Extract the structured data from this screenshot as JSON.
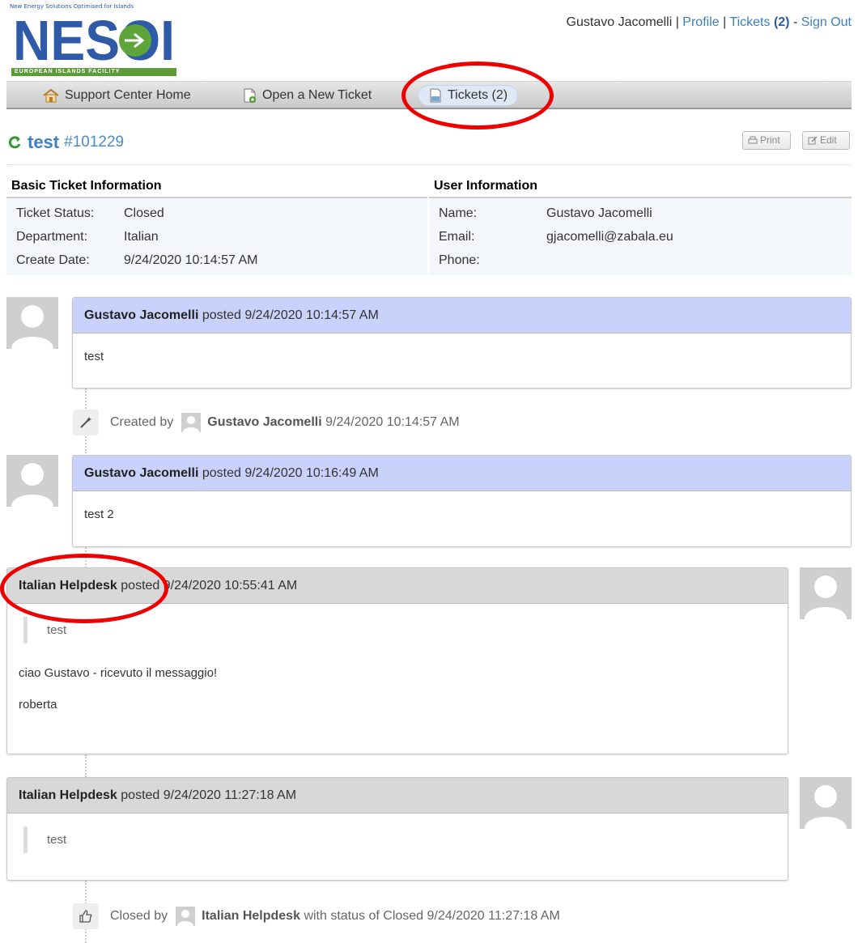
{
  "logo": {
    "tagline": "New Energy Solutions Optimised for Islands",
    "wordmark": "NESOI",
    "banner": "EUROPEAN ISLANDS FACILITY"
  },
  "userbar": {
    "user_name": "Gustavo Jacomelli",
    "sep1": " | ",
    "profile": "Profile",
    "sep2": " | ",
    "tickets_label": "Tickets",
    "tickets_count": "(2)",
    "sep3": " - ",
    "sign_out": "Sign Out"
  },
  "nav": {
    "home": "Support Center Home",
    "new_ticket": "Open a New Ticket",
    "tickets": "Tickets (2)"
  },
  "ticket": {
    "title": "test",
    "number": "#101229",
    "print": "Print",
    "edit": "Edit"
  },
  "basic_info": {
    "heading": "Basic Ticket Information",
    "rows": [
      {
        "label": "Ticket Status:",
        "value": "Closed"
      },
      {
        "label": "Department:",
        "value": "Italian"
      },
      {
        "label": "Create Date:",
        "value": "9/24/2020 10:14:57 AM"
      }
    ]
  },
  "user_info": {
    "heading": "User Information",
    "rows": [
      {
        "label": "Name:",
        "value": "Gustavo Jacomelli"
      },
      {
        "label": "Email:",
        "value": "gjacomelli@zabala.eu"
      },
      {
        "label": "Phone:",
        "value": ""
      }
    ]
  },
  "thread": {
    "m1": {
      "author": "Gustavo Jacomelli",
      "posted": "posted 9/24/2020 10:14:57 AM",
      "body": "test"
    },
    "e1": {
      "prefix": "Created by",
      "author": "Gustavo Jacomelli",
      "suffix": "9/24/2020 10:14:57 AM"
    },
    "m2": {
      "author": "Gustavo Jacomelli",
      "posted": "posted 9/24/2020 10:16:49 AM",
      "body": "test 2"
    },
    "m3": {
      "author": "Italian Helpdesk",
      "posted": "posted 9/24/2020 10:55:41 AM",
      "quote": "test",
      "line1": "ciao Gustavo - ricevuto il messaggio!",
      "line2": "roberta"
    },
    "m4": {
      "author": "Italian Helpdesk",
      "posted": "posted 9/24/2020 11:27:18 AM",
      "quote": "test"
    },
    "e2": {
      "prefix": "Closed by",
      "author": "Italian Helpdesk",
      "suffix": "with status of Closed 9/24/2020 11:27:18 AM"
    }
  },
  "colors": {
    "link": "#3d7fc1",
    "user_header": "#c8d2fa",
    "staff_header": "#d8d8d8",
    "annotation_red": "#e00000"
  }
}
